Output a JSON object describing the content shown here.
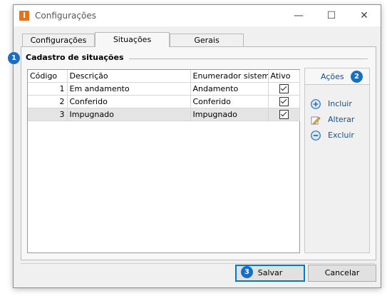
{
  "window": {
    "title": "Configurações",
    "app_icon_letter": "I",
    "controls": {
      "minimize": "—",
      "maximize": "☐",
      "close": "✕"
    }
  },
  "tabs": [
    {
      "label": "Configurações",
      "active": false
    },
    {
      "label": "Situações",
      "active": true
    },
    {
      "label": "Gerais",
      "active": false
    }
  ],
  "group": {
    "title": "Cadastro de situações",
    "badge": "1"
  },
  "grid": {
    "columns": [
      "Código",
      "Descrição",
      "Enumerador sistema",
      "Ativo"
    ],
    "rows": [
      {
        "codigo": "1",
        "descricao": "Em andamento",
        "enumerador": "Andamento",
        "ativo": true
      },
      {
        "codigo": "2",
        "descricao": "Conferido",
        "enumerador": "Conferido",
        "ativo": true
      },
      {
        "codigo": "3",
        "descricao": "Impugnado",
        "enumerador": "Impugnado",
        "ativo": true
      }
    ],
    "selected_row": 3
  },
  "actions": {
    "title": "Ações",
    "badge": "2",
    "items": [
      {
        "label": "Incluir",
        "icon": "add-circle-icon"
      },
      {
        "label": "Alterar",
        "icon": "pencil-icon"
      },
      {
        "label": "Excluir",
        "icon": "remove-circle-icon"
      }
    ]
  },
  "footer": {
    "save_label": "Salvar",
    "save_badge": "3",
    "cancel_label": "Cancelar"
  },
  "colors": {
    "accent": "#1a6ec0",
    "link": "#1a4f8a",
    "app_icon": "#e8711c"
  }
}
